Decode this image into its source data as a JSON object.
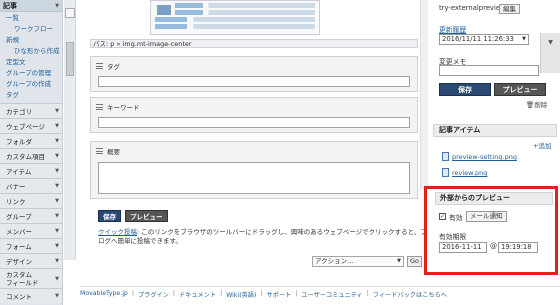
{
  "sidebar": {
    "header": "記事",
    "sub_items": [
      "一覧",
      "ワークフロー",
      "新規",
      "ひな形から作成",
      "定型文",
      "グループの管理",
      "グループの作成",
      "タグ"
    ],
    "sections": [
      "カテゴリ",
      "ウェブページ",
      "フォルダ",
      "カスタム項目",
      "アイテム",
      "バナー",
      "リンク",
      "グループ",
      "メンバー",
      "フォーム",
      "デザイン",
      "カスタム\nフィールド",
      "コメント"
    ]
  },
  "main": {
    "path_bar": "パス: p » img.mt-image-center",
    "fields": [
      {
        "label": "タグ"
      },
      {
        "label": "キーワード"
      },
      {
        "label": "概要"
      }
    ],
    "save_button": "保存",
    "preview_button": "プレビュー",
    "quickpost_link": "クイック投稿",
    "quickpost_text": ": このリンクをブラウザのツールバーにドラッグし、興味のあるウェブページでクリックすると、ブログへ簡単に投稿できます。",
    "action_select": "アクション...",
    "go_button": "Go"
  },
  "right": {
    "entry_title": "try-externalpreview",
    "edit_button": "編集",
    "updated_label": "更新履歴",
    "datetime": "2016/11/11 11:26:33",
    "memo_label": "変更メモ",
    "save_button": "保存",
    "preview_button": "プレビュー",
    "delete_label": "削除",
    "items_header": "記事アイテム",
    "add_link": "追加",
    "files": [
      "preview-setting.png",
      "review.png"
    ],
    "ext_preview": {
      "header": "外部からのプレビュー",
      "enabled_label": "有効",
      "mail_button": "メール通知",
      "period_label": "有効期限",
      "date": "2016-11-11",
      "at": "@",
      "time": "19:19:18"
    }
  },
  "footer": [
    "MovableType.jp",
    "プラグイン",
    "ドキュメント",
    "Wiki(英語)",
    "サポート",
    "ユーザーコミュニティ",
    "フィードバックはこちらへ"
  ],
  "colors": {
    "highlight_border": "#e0201a",
    "save_button": "#2a4a73",
    "link": "#1f5f9a"
  }
}
